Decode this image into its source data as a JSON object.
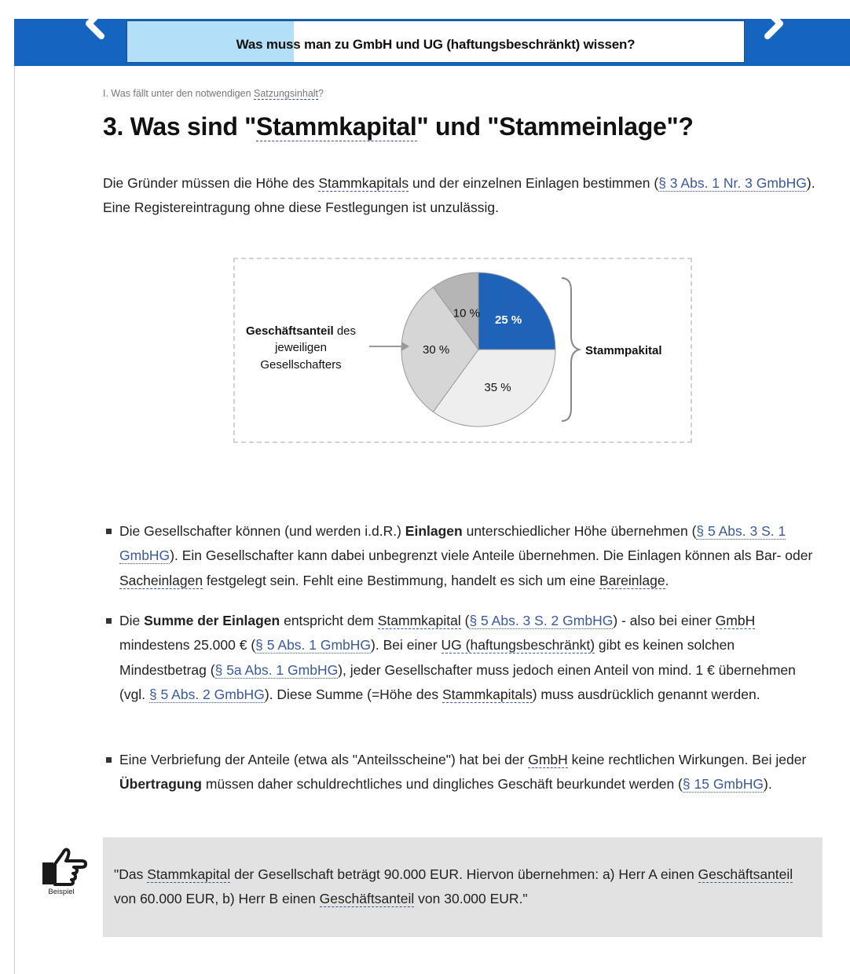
{
  "header": {
    "title": "Was muss man zu GmbH und UG (haftungsbeschränkt) wissen?",
    "progress_percent": 27,
    "prev_icon": "chevron-left-icon",
    "next_icon": "chevron-right-icon",
    "accent_color": "#1565c0",
    "progress_color": "#b3e0f8"
  },
  "breadcrumb": {
    "prefix": "I. Was fällt unter den notwendigen ",
    "term": "Satzungsinhalt",
    "suffix": "?"
  },
  "heading": {
    "part1": "3. Was sind \"",
    "term": "Stammkapital",
    "part2": "\" und \"Stammeinlage\"?"
  },
  "intro": {
    "t1": "Die Gründer müssen die Höhe des ",
    "term1": "Stammkapitals",
    "t2": " und der einzelnen Einlagen bestimmen (",
    "link1": "§ 3 Abs. 1 Nr. 3 GmbHG",
    "t3": "). Eine Registereintragung ohne diese Festlegungen ist unzulässig."
  },
  "figure": {
    "left_label_bold": "Geschäftsanteil",
    "left_label_rest": " des",
    "left_label_line2": "jeweiligen",
    "left_label_line3": "Gesellschafters",
    "right_label": "Stammpakital",
    "chart_data": {
      "type": "pie",
      "slices": [
        {
          "label": "35 %",
          "value": 35,
          "color": "#eeeeee"
        },
        {
          "label": "30 %",
          "value": 30,
          "color": "#d6d6d6"
        },
        {
          "label": "10 %",
          "value": 10,
          "color": "#b5b5b5"
        },
        {
          "label": "25 %",
          "value": 25,
          "color": "#1e63b8"
        }
      ]
    }
  },
  "bullets": [
    {
      "t1": "Die Gesellschafter können (und werden i.d.R.) ",
      "b1": "Einlagen",
      "t2": " unterschiedlicher Höhe übernehmen (",
      "link1": "§ 5 Abs. 3 S. 1 GmbHG",
      "t3": "). Ein Gesellschafter kann dabei unbegrenzt viele Anteile übernehmen. Die Einlagen können als Bar- oder ",
      "term1": "Sacheinlagen",
      "t4": " festgelegt sein. Fehlt eine Bestimmung, handelt es sich um eine ",
      "term2": "Bareinlage",
      "t5": "."
    },
    {
      "t1": "Die ",
      "b1": "Summe der Einlagen",
      "t2": " entspricht dem ",
      "term1": "Stammkapital",
      "t3": " (",
      "link1": "§ 5 Abs. 3 S. 2 GmbHG",
      "t4": ") - also bei einer ",
      "term2": "GmbH",
      "t5": " mindestens 25.000 € (",
      "link2": "§ 5 Abs. 1 GmbHG",
      "t6": "). Bei einer ",
      "term3": "UG (haftungsbeschränkt)",
      "t7": " gibt es keinen solchen Mindestbetrag (",
      "link3": "§ 5a Abs. 1 GmbHG",
      "t8": "), jeder Gesellschafter muss jedoch einen Anteil von mind. 1 € übernehmen (vgl. ",
      "link4": "§ 5 Abs. 2 GmbHG",
      "t9": "). Diese Summe (=Höhe des ",
      "term4": "Stammkapitals",
      "t10": ") muss ausdrücklich genannt werden."
    },
    {
      "t1": "Eine Verbriefung der Anteile (etwa als \"Anteilsscheine\") hat bei der ",
      "term1": "GmbH",
      "t2": " keine rechtlichen Wirkungen. Bei jeder ",
      "b1": "Übertragung",
      "t3": " müssen daher schuldrechtliches und dingliches Geschäft beurkundet werden (",
      "link1": "§ 15 GmbHG",
      "t4": ")."
    }
  ],
  "example": {
    "icon": "pointing-hand-icon",
    "label": "Beispiel",
    "t1": "\"Das ",
    "term1": "Stammkapital",
    "t2": " der Gesellschaft beträgt 90.000 EUR. Hiervon übernehmen: a) Herr A einen ",
    "term2": "Geschäftsanteil",
    "t3": " von 60.000 EUR, b) Herr B einen ",
    "term3": "Geschäftsanteil",
    "t4": " von 30.000 EUR.\""
  }
}
